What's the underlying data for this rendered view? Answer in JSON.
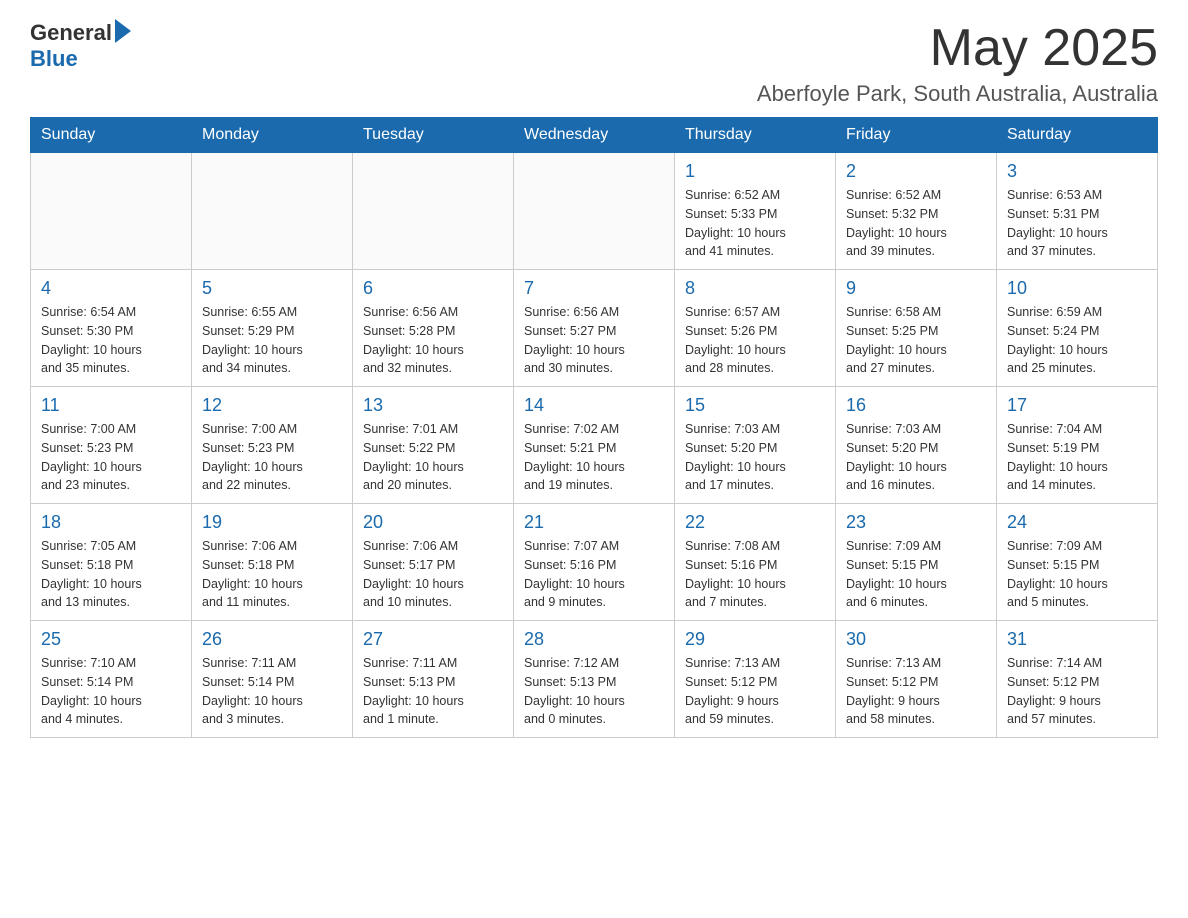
{
  "header": {
    "logo": {
      "general": "General",
      "blue": "Blue"
    },
    "title": "May 2025",
    "location": "Aberfoyle Park, South Australia, Australia"
  },
  "calendar": {
    "days_of_week": [
      "Sunday",
      "Monday",
      "Tuesday",
      "Wednesday",
      "Thursday",
      "Friday",
      "Saturday"
    ],
    "weeks": [
      {
        "cells": [
          {
            "day": "",
            "info": ""
          },
          {
            "day": "",
            "info": ""
          },
          {
            "day": "",
            "info": ""
          },
          {
            "day": "",
            "info": ""
          },
          {
            "day": "1",
            "info": "Sunrise: 6:52 AM\nSunset: 5:33 PM\nDaylight: 10 hours\nand 41 minutes."
          },
          {
            "day": "2",
            "info": "Sunrise: 6:52 AM\nSunset: 5:32 PM\nDaylight: 10 hours\nand 39 minutes."
          },
          {
            "day": "3",
            "info": "Sunrise: 6:53 AM\nSunset: 5:31 PM\nDaylight: 10 hours\nand 37 minutes."
          }
        ]
      },
      {
        "cells": [
          {
            "day": "4",
            "info": "Sunrise: 6:54 AM\nSunset: 5:30 PM\nDaylight: 10 hours\nand 35 minutes."
          },
          {
            "day": "5",
            "info": "Sunrise: 6:55 AM\nSunset: 5:29 PM\nDaylight: 10 hours\nand 34 minutes."
          },
          {
            "day": "6",
            "info": "Sunrise: 6:56 AM\nSunset: 5:28 PM\nDaylight: 10 hours\nand 32 minutes."
          },
          {
            "day": "7",
            "info": "Sunrise: 6:56 AM\nSunset: 5:27 PM\nDaylight: 10 hours\nand 30 minutes."
          },
          {
            "day": "8",
            "info": "Sunrise: 6:57 AM\nSunset: 5:26 PM\nDaylight: 10 hours\nand 28 minutes."
          },
          {
            "day": "9",
            "info": "Sunrise: 6:58 AM\nSunset: 5:25 PM\nDaylight: 10 hours\nand 27 minutes."
          },
          {
            "day": "10",
            "info": "Sunrise: 6:59 AM\nSunset: 5:24 PM\nDaylight: 10 hours\nand 25 minutes."
          }
        ]
      },
      {
        "cells": [
          {
            "day": "11",
            "info": "Sunrise: 7:00 AM\nSunset: 5:23 PM\nDaylight: 10 hours\nand 23 minutes."
          },
          {
            "day": "12",
            "info": "Sunrise: 7:00 AM\nSunset: 5:23 PM\nDaylight: 10 hours\nand 22 minutes."
          },
          {
            "day": "13",
            "info": "Sunrise: 7:01 AM\nSunset: 5:22 PM\nDaylight: 10 hours\nand 20 minutes."
          },
          {
            "day": "14",
            "info": "Sunrise: 7:02 AM\nSunset: 5:21 PM\nDaylight: 10 hours\nand 19 minutes."
          },
          {
            "day": "15",
            "info": "Sunrise: 7:03 AM\nSunset: 5:20 PM\nDaylight: 10 hours\nand 17 minutes."
          },
          {
            "day": "16",
            "info": "Sunrise: 7:03 AM\nSunset: 5:20 PM\nDaylight: 10 hours\nand 16 minutes."
          },
          {
            "day": "17",
            "info": "Sunrise: 7:04 AM\nSunset: 5:19 PM\nDaylight: 10 hours\nand 14 minutes."
          }
        ]
      },
      {
        "cells": [
          {
            "day": "18",
            "info": "Sunrise: 7:05 AM\nSunset: 5:18 PM\nDaylight: 10 hours\nand 13 minutes."
          },
          {
            "day": "19",
            "info": "Sunrise: 7:06 AM\nSunset: 5:18 PM\nDaylight: 10 hours\nand 11 minutes."
          },
          {
            "day": "20",
            "info": "Sunrise: 7:06 AM\nSunset: 5:17 PM\nDaylight: 10 hours\nand 10 minutes."
          },
          {
            "day": "21",
            "info": "Sunrise: 7:07 AM\nSunset: 5:16 PM\nDaylight: 10 hours\nand 9 minutes."
          },
          {
            "day": "22",
            "info": "Sunrise: 7:08 AM\nSunset: 5:16 PM\nDaylight: 10 hours\nand 7 minutes."
          },
          {
            "day": "23",
            "info": "Sunrise: 7:09 AM\nSunset: 5:15 PM\nDaylight: 10 hours\nand 6 minutes."
          },
          {
            "day": "24",
            "info": "Sunrise: 7:09 AM\nSunset: 5:15 PM\nDaylight: 10 hours\nand 5 minutes."
          }
        ]
      },
      {
        "cells": [
          {
            "day": "25",
            "info": "Sunrise: 7:10 AM\nSunset: 5:14 PM\nDaylight: 10 hours\nand 4 minutes."
          },
          {
            "day": "26",
            "info": "Sunrise: 7:11 AM\nSunset: 5:14 PM\nDaylight: 10 hours\nand 3 minutes."
          },
          {
            "day": "27",
            "info": "Sunrise: 7:11 AM\nSunset: 5:13 PM\nDaylight: 10 hours\nand 1 minute."
          },
          {
            "day": "28",
            "info": "Sunrise: 7:12 AM\nSunset: 5:13 PM\nDaylight: 10 hours\nand 0 minutes."
          },
          {
            "day": "29",
            "info": "Sunrise: 7:13 AM\nSunset: 5:12 PM\nDaylight: 9 hours\nand 59 minutes."
          },
          {
            "day": "30",
            "info": "Sunrise: 7:13 AM\nSunset: 5:12 PM\nDaylight: 9 hours\nand 58 minutes."
          },
          {
            "day": "31",
            "info": "Sunrise: 7:14 AM\nSunset: 5:12 PM\nDaylight: 9 hours\nand 57 minutes."
          }
        ]
      }
    ]
  }
}
